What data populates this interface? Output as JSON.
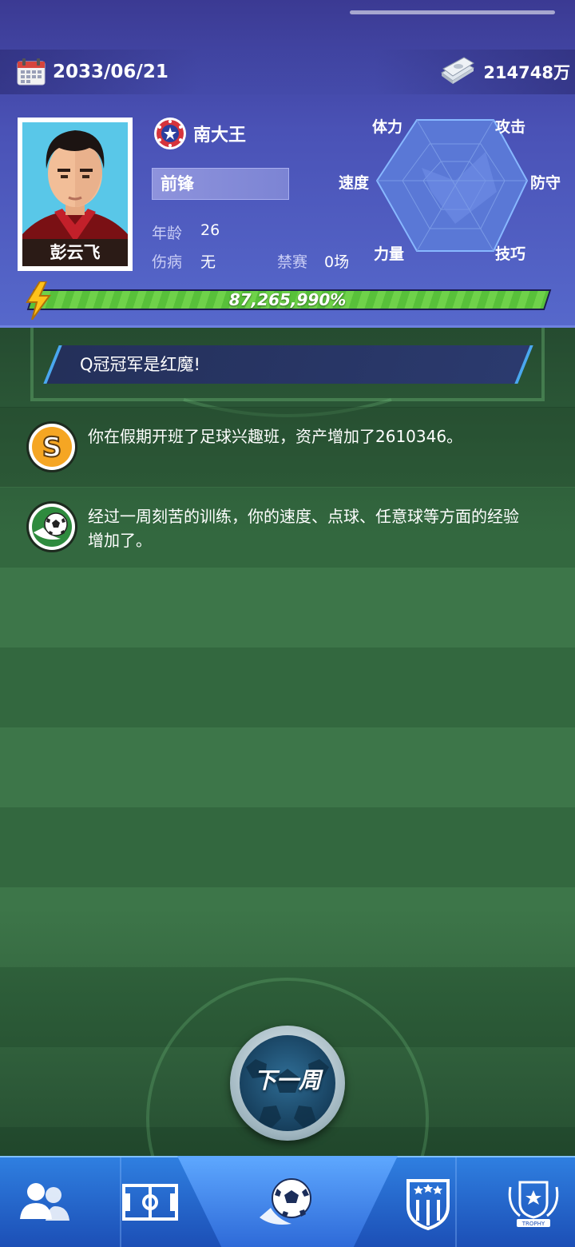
{
  "header": {
    "date": "2033/06/21",
    "money": "214748万"
  },
  "player": {
    "name": "彭云飞",
    "team": "南大王",
    "position": "前锋",
    "age_label": "年龄",
    "age": "26",
    "injury_label": "伤病",
    "injury": "无",
    "ban_label": "禁赛",
    "ban": "0场",
    "xp_text": "87,265,990%",
    "xp_fill": 1.0
  },
  "radar": {
    "labels": {
      "stamina": "体力",
      "attack": "攻击",
      "speed": "速度",
      "defense": "防守",
      "strength": "力量",
      "skill": "技巧"
    }
  },
  "news": {
    "headline": "Q冠冠军是红魔!"
  },
  "events": [
    {
      "icon": "coin-s-icon",
      "text": "你在假期开班了足球兴趣班，资产增加了2610346。"
    },
    {
      "icon": "soccer-ball-icon",
      "text": "经过一周刻苦的训练，你的速度、点球、任意球等方面的经验增加了。"
    }
  ],
  "actions": {
    "next_week": "下一周"
  },
  "nav": {
    "items": [
      {
        "icon": "team-players-icon"
      },
      {
        "icon": "pitch-icon"
      },
      {
        "icon": "soccer-ball-icon",
        "active": true
      },
      {
        "icon": "club-badge-icon"
      },
      {
        "icon": "trophy-icon",
        "text": "TROPHY"
      }
    ]
  },
  "colors": {
    "header_bg": "#4a52b6",
    "field_green": "#3d7649",
    "xp_green": "#58c03a",
    "nav_blue": "#2f7fe0",
    "accent_blue": "#4aa7f0"
  }
}
